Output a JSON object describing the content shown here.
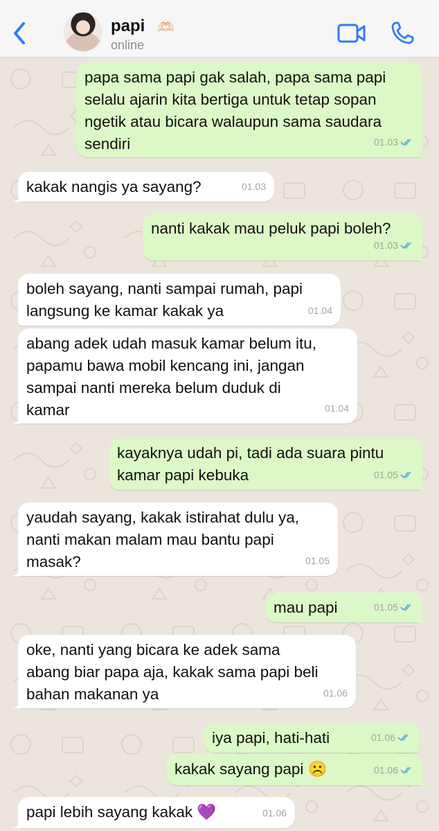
{
  "header": {
    "back_icon": "chevron-left-icon",
    "contact_name": "papi",
    "contact_emoji": "🫶🏻",
    "status": "online",
    "video_icon": "video-camera-icon",
    "call_icon": "phone-icon",
    "accent_color": "#2f7bf6"
  },
  "messages": [
    {
      "direction": "out",
      "text": "papa sama papi gak salah, papa sama papi\nselalu ajarin kita bertiga untuk tetap sopan\nngetik atau bicara walaupun sama saudara\nsendiri",
      "time": "01.03",
      "read": true
    },
    {
      "direction": "in",
      "text": "kakak nangis ya sayang?",
      "time": "01.03"
    },
    {
      "direction": "out",
      "text": "nanti kakak mau peluk papi boleh?",
      "time": "01.03",
      "read": true
    },
    {
      "direction": "in",
      "text": "boleh sayang, nanti sampai rumah, papi\nlangsung ke kamar kakak ya",
      "time": "01.04"
    },
    {
      "direction": "in",
      "text": "abang adek udah masuk kamar belum itu,\npapamu bawa mobil kencang ini, jangan\nsampai nanti mereka belum duduk di\nkamar",
      "time": "01.04"
    },
    {
      "direction": "out",
      "text": "kayaknya udah pi, tadi ada suara pintu\nkamar papi kebuka",
      "time": "01.05",
      "read": true
    },
    {
      "direction": "in",
      "text": "yaudah sayang, kakak istirahat dulu ya,\nnanti makan malam mau bantu papi\nmasak?",
      "time": "01.05"
    },
    {
      "direction": "out",
      "text": "mau papi",
      "time": "01.05",
      "read": true
    },
    {
      "direction": "in",
      "text": "oke, nanti yang bicara ke adek sama\nabang biar papa aja, kakak sama papi beli\nbahan makanan ya",
      "time": "01.06"
    },
    {
      "direction": "out",
      "text": "iya papi, hati-hati",
      "time": "01.06",
      "read": true
    },
    {
      "direction": "out",
      "text": "kakak sayang papi ☹️",
      "time": "01.06",
      "read": true
    },
    {
      "direction": "in",
      "text": "papi lebih sayang kakak 💜",
      "time": "01.06"
    }
  ],
  "colors": {
    "outgoing_bubble": "#dcf8c6",
    "incoming_bubble": "#ffffff",
    "wallpaper": "#ece5dd",
    "read_ticks": "#4fa3e0"
  }
}
